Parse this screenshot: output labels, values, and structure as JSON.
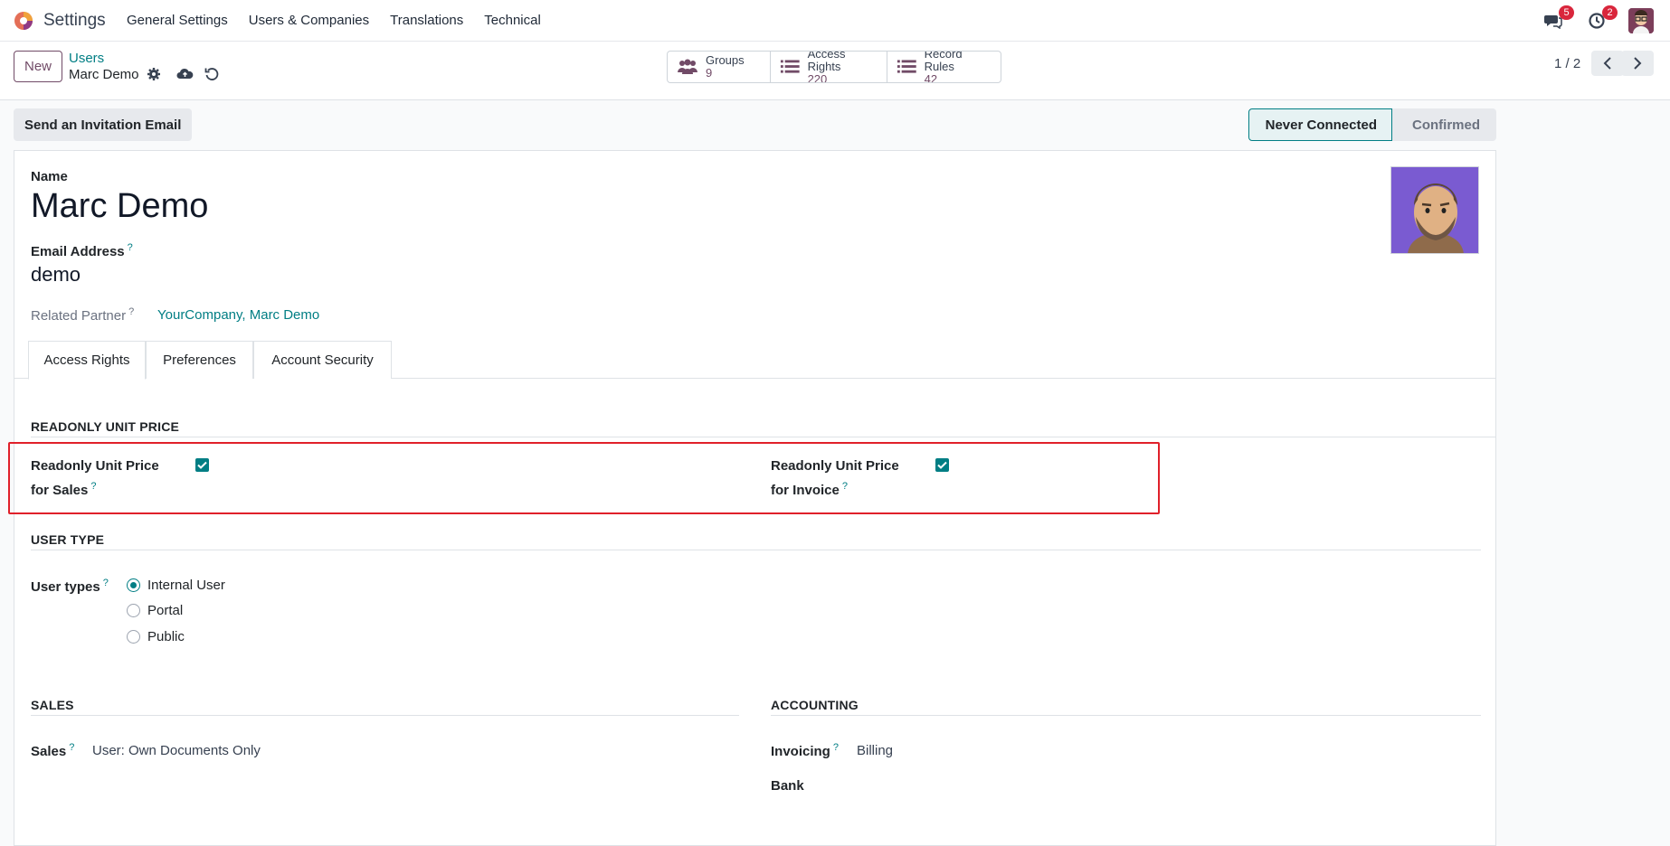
{
  "navbar": {
    "app_name": "Settings",
    "menu": [
      "General Settings",
      "Users & Companies",
      "Translations",
      "Technical"
    ],
    "messages_badge": "5",
    "activity_badge": "2"
  },
  "control_panel": {
    "new_label": "New",
    "breadcrumb_parent": "Users",
    "breadcrumb_current": "Marc Demo",
    "smart_buttons": [
      {
        "title": "Groups",
        "count": "9",
        "icon": "groups-icon"
      },
      {
        "title": "Access Rights",
        "count": "220",
        "icon": "list-icon"
      },
      {
        "title": "Record Rules",
        "count": "42",
        "icon": "list-icon"
      }
    ],
    "pager": "1 / 2"
  },
  "header": {
    "invite_label": "Send an Invitation Email",
    "stages": [
      "Never Connected",
      "Confirmed"
    ],
    "active_stage": "Never Connected"
  },
  "form": {
    "name_label": "Name",
    "name_value": "Marc Demo",
    "email_label": "Email Address",
    "email_value": "demo",
    "related_label": "Related Partner",
    "related_value": "YourCompany, Marc Demo",
    "help_mark": "?",
    "tabs": [
      "Access Rights",
      "Preferences",
      "Account Security"
    ],
    "active_tab": "Access Rights",
    "readonly_section": "READONLY UNIT PRICE",
    "readonly_sales_line1": "Readonly Unit Price",
    "readonly_sales_line2": "for Sales",
    "readonly_sales_checked": true,
    "readonly_invoice_line1": "Readonly Unit Price",
    "readonly_invoice_line2": "for Invoice",
    "readonly_invoice_checked": true,
    "user_type_section": "USER TYPE",
    "user_types_label": "User types",
    "user_types": [
      "Internal User",
      "Portal",
      "Public"
    ],
    "user_type_selected": "Internal User",
    "sales_section": "SALES",
    "sales_label": "Sales",
    "sales_value": "User: Own Documents Only",
    "accounting_section": "ACCOUNTING",
    "invoicing_label": "Invoicing",
    "invoicing_value": "Billing",
    "bank_label": "Bank"
  },
  "colors": {
    "brand": "#714b67",
    "accent": "#017e84",
    "badge": "#d9263c",
    "highlight": "#e0202a"
  }
}
